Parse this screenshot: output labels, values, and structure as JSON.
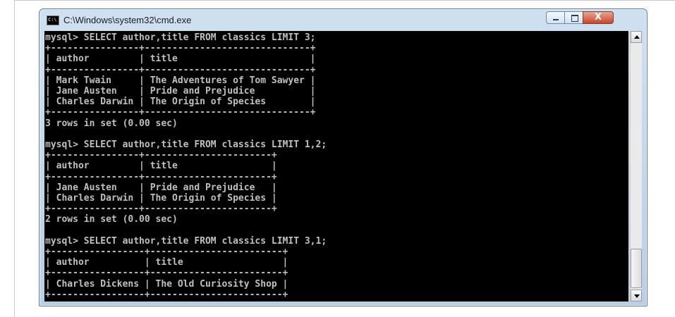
{
  "window": {
    "title": "C:\\Windows\\system32\\cmd.exe",
    "controls": {
      "minimize_icon": "minimize-icon",
      "maximize_icon": "maximize-icon",
      "close_icon": "close-icon",
      "close_glyph": "X"
    },
    "app_icon_text": "C:\\"
  },
  "console": {
    "lines": [
      "mysql> SELECT author,title FROM classics LIMIT 3;",
      "+----------------+------------------------------+",
      "| author         | title                        |",
      "+----------------+------------------------------+",
      "| Mark Twain     | The Adventures of Tom Sawyer |",
      "| Jane Austen    | Pride and Prejudice          |",
      "| Charles Darwin | The Origin of Species        |",
      "+----------------+------------------------------+",
      "3 rows in set (0.00 sec)",
      "",
      "mysql> SELECT author,title FROM classics LIMIT 1,2;",
      "+----------------+-----------------------+",
      "| author         | title                 |",
      "+----------------+-----------------------+",
      "| Jane Austen    | Pride and Prejudice   |",
      "| Charles Darwin | The Origin of Species |",
      "+----------------+-----------------------+",
      "2 rows in set (0.00 sec)",
      "",
      "mysql> SELECT author,title FROM classics LIMIT 3,1;",
      "+-----------------+------------------------+",
      "| author          | title                  |",
      "+-----------------+------------------------+",
      "| Charles Dickens | The Old Curiosity Shop |",
      "+-----------------+------------------------+"
    ]
  },
  "colors": {
    "console_bg": "#000000",
    "console_fg": "#c0c0c0",
    "titlebar": "#cfe0f1",
    "close_button": "#c9452b"
  }
}
